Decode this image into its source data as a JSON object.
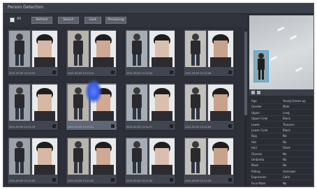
{
  "window": {
    "title": "Person Detection"
  },
  "toolbar": {
    "select_all_label": "All",
    "buttons": [
      "Refresh",
      "Search",
      "Lock",
      "PersonLog"
    ]
  },
  "grid": {
    "cards": [
      {
        "caption": "2021-09-09 13:13:10"
      },
      {
        "caption": "2021-09-09 13:13:10"
      },
      {
        "caption": "2021-09-09 13:12:54"
      },
      {
        "caption": "2021-09-09 13:12:48"
      },
      {
        "caption": "2021-09-09 13:12:33"
      },
      {
        "caption": "2021-09-09 13:12:21"
      },
      {
        "caption": "2021-09-09 13:12:17"
      },
      {
        "caption": "2021-09-09 13:12:09"
      },
      {
        "caption": "2021-09-09 13:11:55"
      },
      {
        "caption": "2021-09-09 13:11:42"
      },
      {
        "caption": "2021-09-09 13:11:30"
      },
      {
        "caption": "2021-09-09 13:11:18"
      }
    ]
  },
  "details": {
    "rows": [
      {
        "k": "Age",
        "v": "Young Grown-up"
      },
      {
        "k": "Gender",
        "v": "Male"
      },
      {
        "k": "Upper",
        "v": "Long"
      },
      {
        "k": "Upper Color",
        "v": "Black"
      },
      {
        "k": "Lower",
        "v": "Trousers"
      },
      {
        "k": "Lower Color",
        "v": "Black"
      },
      {
        "k": "Bag",
        "v": "No"
      },
      {
        "k": "Hat",
        "v": "No"
      },
      {
        "k": "Hair",
        "v": "Short"
      },
      {
        "k": "Glasses",
        "v": "No"
      },
      {
        "k": "Umbrella",
        "v": "No"
      },
      {
        "k": "Mask",
        "v": "No"
      },
      {
        "k": "Riding",
        "v": "Unknown"
      },
      {
        "k": "Expression",
        "v": "Calm"
      },
      {
        "k": "Face Mask",
        "v": "No"
      }
    ]
  },
  "colors": {
    "frame_bg": "#2d3038",
    "accent": "#3a5ce0"
  }
}
